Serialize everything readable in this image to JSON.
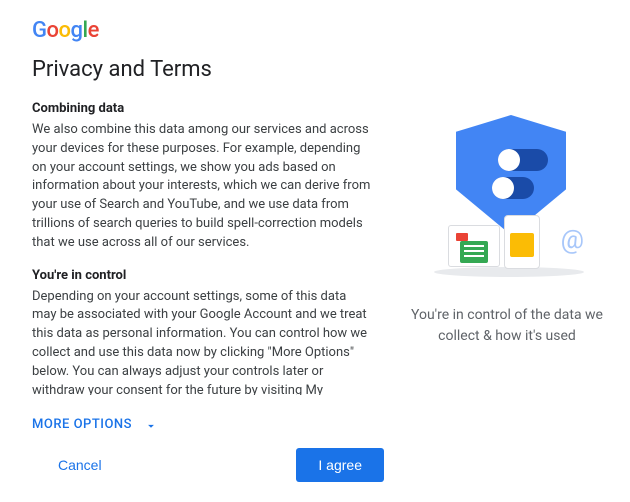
{
  "logo": {
    "g1": "G",
    "o1": "o",
    "o2": "o",
    "g2": "g",
    "l": "l",
    "e": "e"
  },
  "title": "Privacy and Terms",
  "sections": {
    "combining": {
      "heading": "Combining data",
      "body": "We also combine this data among our services and across your devices for these purposes. For example, depending on your account settings, we show you ads based on information about your interests, which we can derive from your use of Search and YouTube, and we use data from trillions of search queries to build spell-correction models that we use across all of our services."
    },
    "control": {
      "heading": "You're in control",
      "body": "Depending on your account settings, some of this data may be associated with your Google Account and we treat this data as personal information. You can control how we collect and use this data now by clicking \"More Options\" below. You can always adjust your controls later or withdraw your consent for the future by visiting My Account (myaccount.google.com)."
    }
  },
  "more_options": "MORE OPTIONS",
  "actions": {
    "cancel": "Cancel",
    "agree": "I agree"
  },
  "right": {
    "caption": "You're in control of the data we collect & how it's used",
    "at": "@"
  }
}
